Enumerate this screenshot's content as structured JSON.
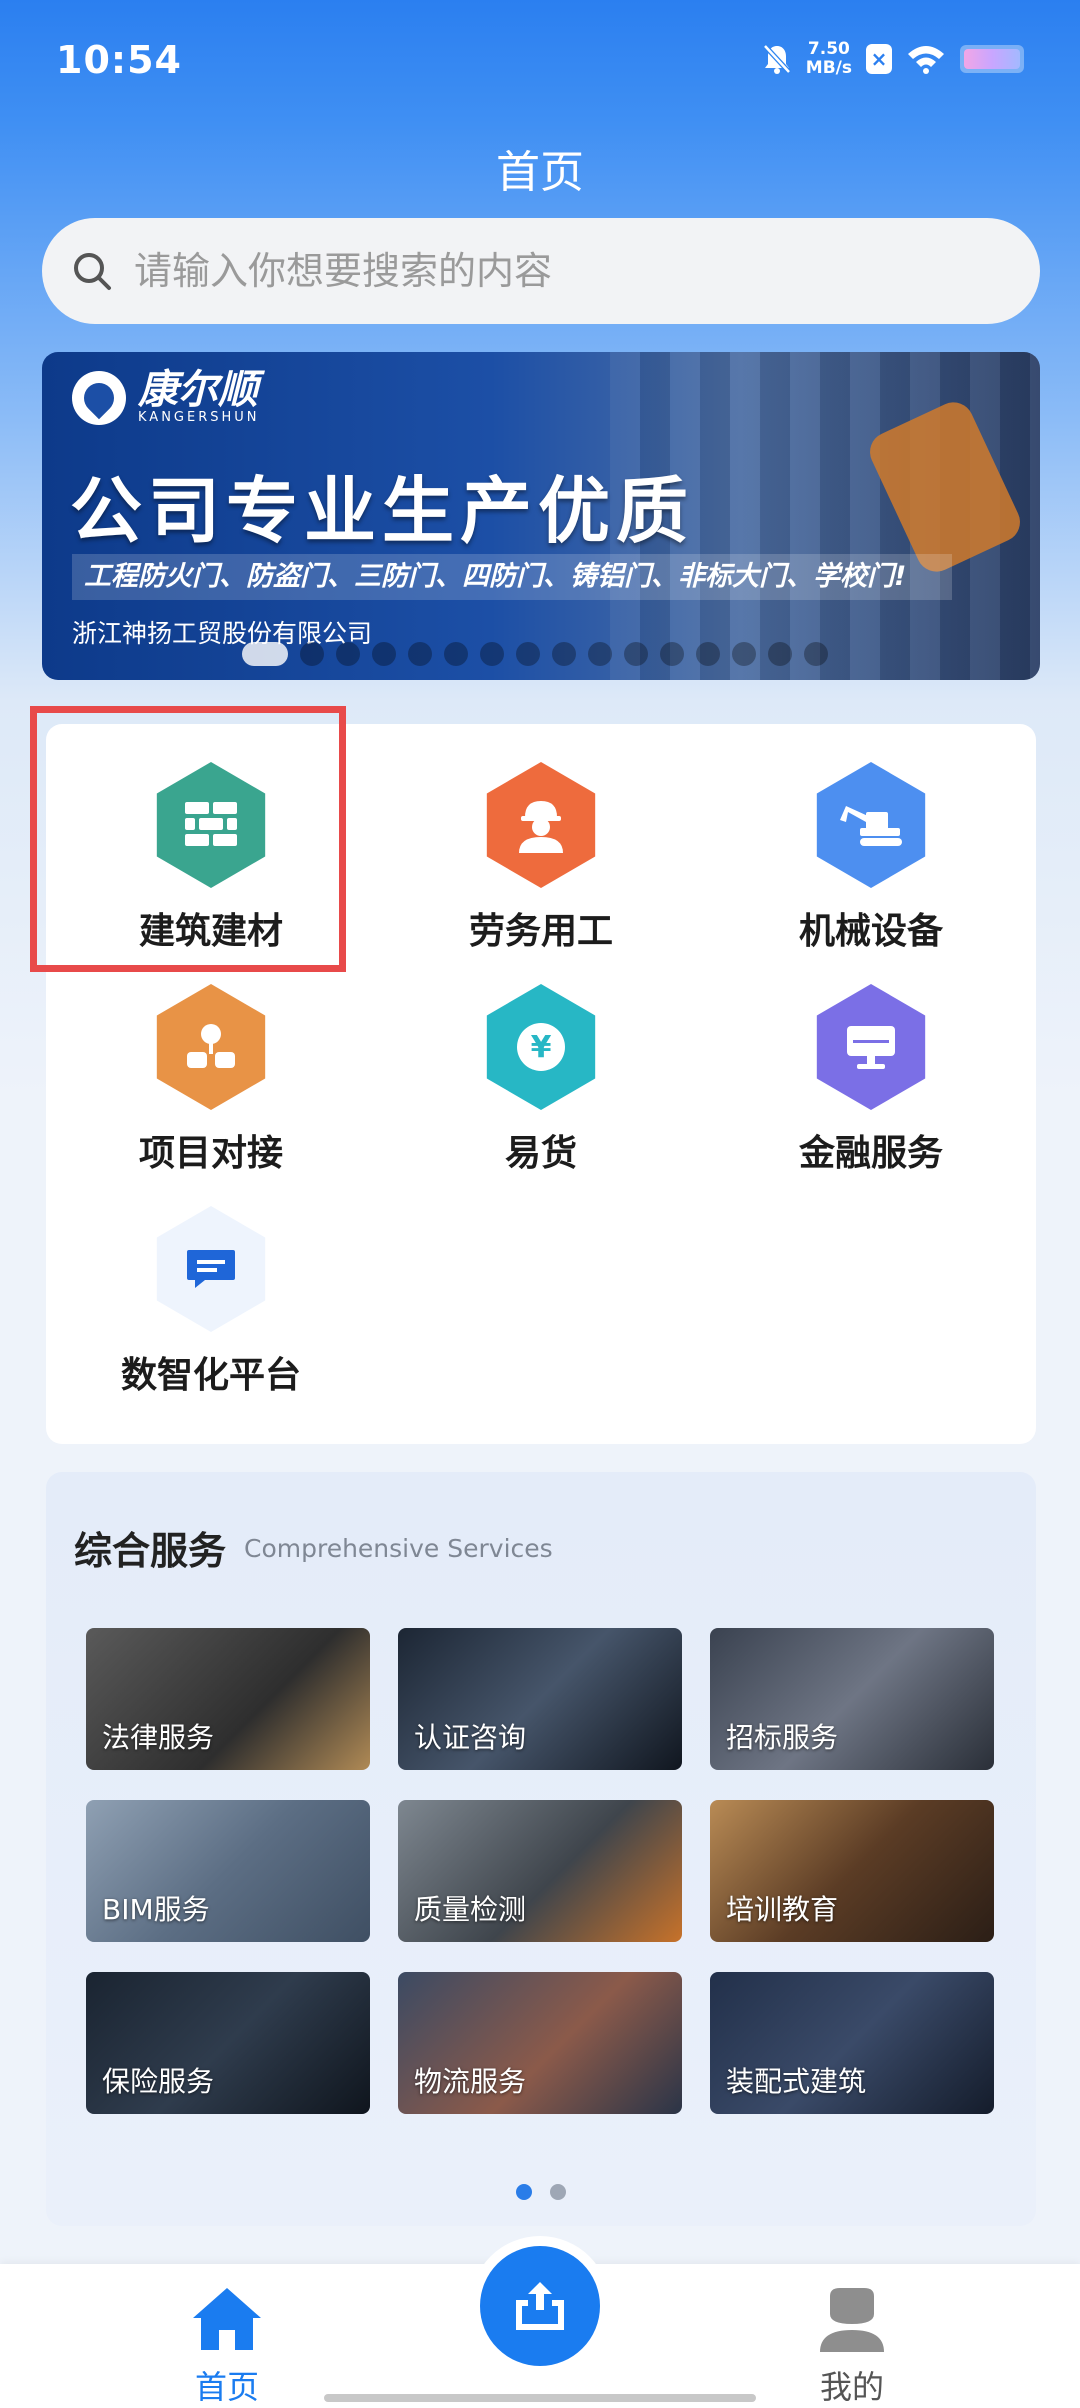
{
  "status_bar": {
    "time": "10:54",
    "net_speed": "7.50",
    "net_unit": "MB/s"
  },
  "header": {
    "title": "首页"
  },
  "search": {
    "placeholder": "请输入你想要搜索的内容"
  },
  "banner": {
    "logo_cn": "康尔顺",
    "logo_en": "KANGERSHUN",
    "headline": "公司专业生产优质",
    "products": "工程防火门、防盗门、三防门、四防门、铸铝门、非标大门、学校门!",
    "company": "浙江神扬工贸股份有限公司",
    "page_count": 16,
    "active_index": 0
  },
  "categories": [
    {
      "label": "建筑建材",
      "icon": "brick-wall-icon",
      "color": "#3aa58f"
    },
    {
      "label": "劳务用工",
      "icon": "worker-icon",
      "color": "#ee6b3d"
    },
    {
      "label": "机械设备",
      "icon": "excavator-icon",
      "color": "#4d8ff0"
    },
    {
      "label": "项目对接",
      "icon": "org-chart-icon",
      "color": "#e89346"
    },
    {
      "label": "易货",
      "icon": "yuan-icon",
      "color": "#27b7c5"
    },
    {
      "label": "金融服务",
      "icon": "monitor-icon",
      "color": "#7b6fe6"
    },
    {
      "label": "数智化平台",
      "icon": "chat-message-icon",
      "color": "#1f66d8"
    }
  ],
  "services": {
    "title": "综合服务",
    "subtitle": "Comprehensive Services",
    "items": [
      {
        "label": "法律服务"
      },
      {
        "label": "认证咨询"
      },
      {
        "label": "招标服务"
      },
      {
        "label": "BIM服务"
      },
      {
        "label": "质量检测"
      },
      {
        "label": "培训教育"
      },
      {
        "label": "保险服务"
      },
      {
        "label": "物流服务"
      },
      {
        "label": "装配式建筑"
      }
    ],
    "page_count": 2,
    "active_page": 0
  },
  "tab_bar": {
    "home_label": "首页",
    "mine_label": "我的",
    "accent": "#1a7cf0"
  }
}
